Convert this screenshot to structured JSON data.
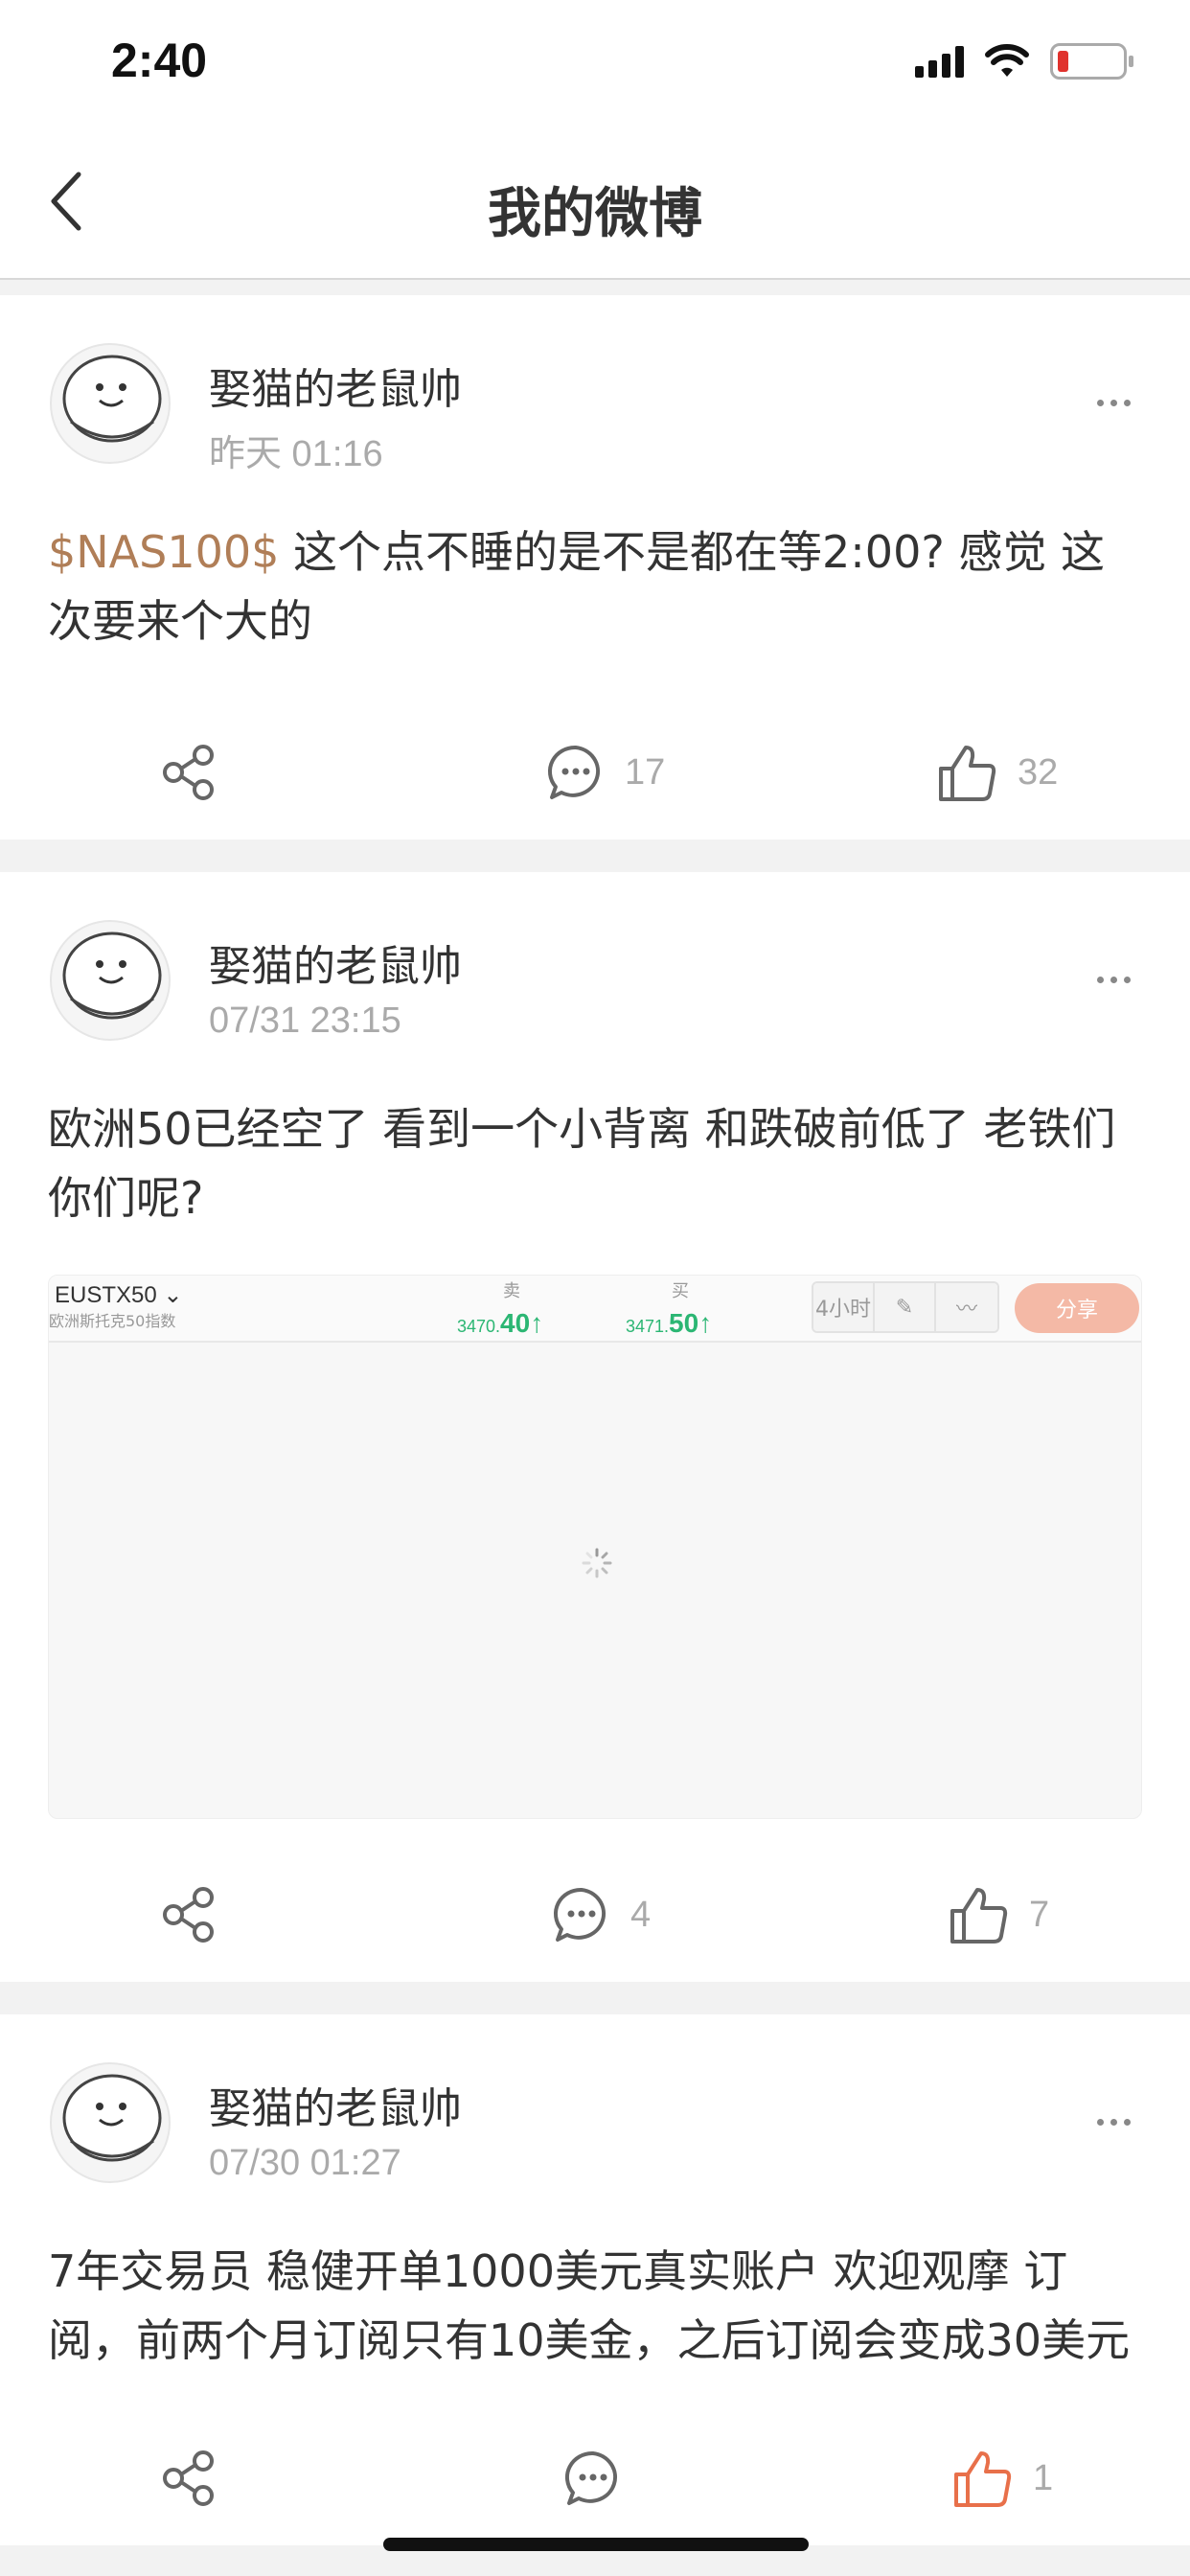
{
  "status_bar": {
    "time": "2:40"
  },
  "nav": {
    "title": "我的微博"
  },
  "posts": [
    {
      "author": "娶猫的老鼠帅",
      "time": "昨天 01:16",
      "tag": "$NAS100$",
      "text": " 这个点不睡的是不是都在等2:00? 感觉 这次要来个大的",
      "comments": "17",
      "likes": "32"
    },
    {
      "author": "娶猫的老鼠帅",
      "time": "07/31 23:15",
      "text": "欧洲50已经空了 看到一个小背离 和跌破前低了 老铁们 你们呢?",
      "image": {
        "symbol": "EUSTX50",
        "symbol_sub": "欧洲斯托克50指数",
        "sell_label": "卖",
        "sell_int": "3470.",
        "sell_dec": "40",
        "buy_label": "买",
        "buy_int": "3471.",
        "buy_dec": "50",
        "timeframe": "4小时",
        "share_label": "分享"
      },
      "comments": "4",
      "likes": "7"
    },
    {
      "author": "娶猫的老鼠帅",
      "time": "07/30 01:27",
      "text": "7年交易员 稳健开单1000美元真实账户 欢迎观摩 订阅，前两个月订阅只有10美金，之后订阅会变成30美元",
      "comments": "",
      "likes": "1"
    }
  ],
  "colors": {
    "tag": "#b07e57",
    "liked": "#e8704a",
    "buy_sell_green": "#2bb673"
  }
}
